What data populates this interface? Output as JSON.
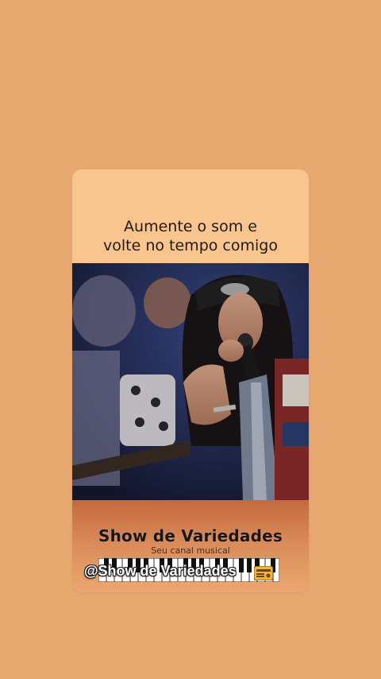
{
  "caption": {
    "line1": "Aumente o som e",
    "line2": "volte no tempo comigo"
  },
  "video": {
    "description_icon": "video-frame"
  },
  "brand": {
    "title": "Show de Variedades",
    "subtitle": "Seu canal musical"
  },
  "watermark": {
    "handle": "@Show de Variedades",
    "badge_icon": "radio-icon"
  },
  "colors": {
    "background": "#E7A96F",
    "card": "#F9C58E",
    "accent": "#C5693F"
  }
}
